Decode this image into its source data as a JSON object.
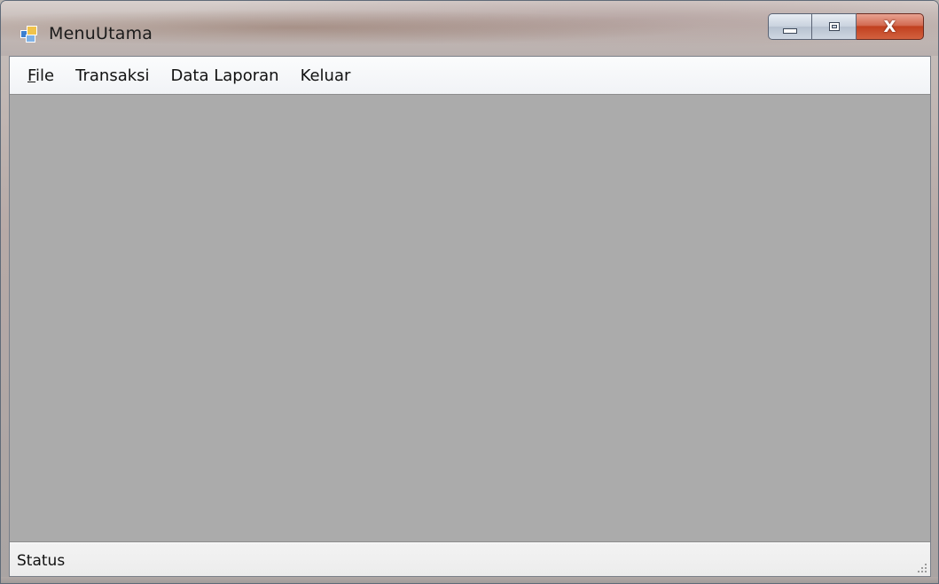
{
  "window": {
    "title": "MenuUtama",
    "close_glyph": "X",
    "app_icon": "windows-form-icon",
    "title_buttons": [
      "minimize-icon",
      "maximize-icon",
      "close-icon"
    ]
  },
  "menubar": {
    "items": [
      {
        "label_underlined": "F",
        "label_rest": "ile"
      },
      {
        "label": "Transaksi"
      },
      {
        "label": "Data Laporan"
      },
      {
        "label": "Keluar"
      }
    ]
  },
  "statusbar": {
    "label": "Status",
    "grip_icon": "size-grip-icon"
  },
  "colors": {
    "mdi_background": "#ababab",
    "menubar_background": "#f1f3f6",
    "close_button": "#c1401f"
  }
}
